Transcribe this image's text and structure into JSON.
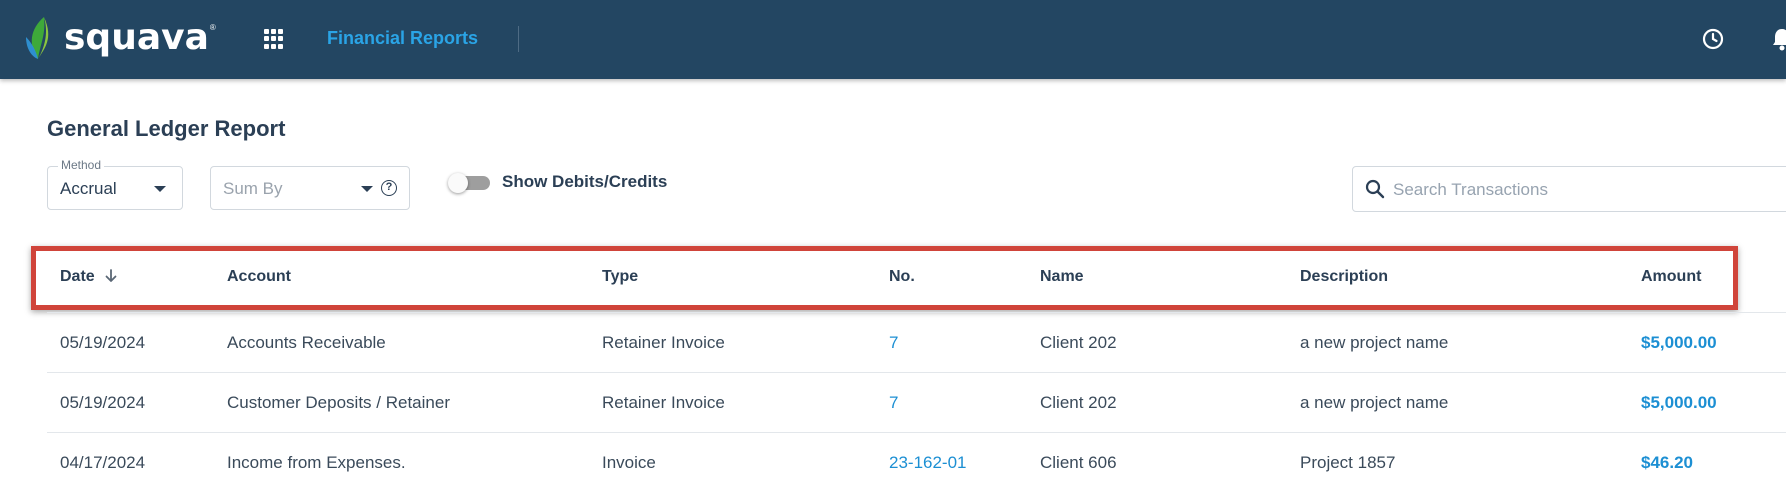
{
  "header": {
    "logo_text": "squava",
    "logo_reg": "®",
    "module_title": "Financial Reports",
    "icons": [
      "apps-grid-icon",
      "clock-icon",
      "bell-icon"
    ]
  },
  "page": {
    "title": "General Ledger Report"
  },
  "filters": {
    "method_label": "Method",
    "method_value": "Accrual",
    "sumby_placeholder": "Sum By",
    "help_glyph": "?",
    "toggle_label": "Show Debits/Credits",
    "toggle_on": false,
    "search_placeholder": "Search Transactions"
  },
  "table": {
    "headers": {
      "date": "Date",
      "account": "Account",
      "type": "Type",
      "no": "No.",
      "name": "Name",
      "description": "Description",
      "amount": "Amount"
    },
    "sort": {
      "column": "Date",
      "direction": "descending"
    },
    "rows": [
      {
        "date": "05/19/2024",
        "account": "Accounts Receivable",
        "type": "Retainer Invoice",
        "no": "7",
        "name": "Client 202",
        "description": "a new project name",
        "amount": "$5,000.00"
      },
      {
        "date": "05/19/2024",
        "account": "Customer Deposits / Retainer",
        "type": "Retainer Invoice",
        "no": "7",
        "name": "Client 202",
        "description": "a new project name",
        "amount": "$5,000.00"
      },
      {
        "date": "04/17/2024",
        "account": "Income from Expenses.",
        "type": "Invoice",
        "no": "23-162-01",
        "name": "Client 606",
        "description": "Project 1857",
        "amount": "$46.20"
      }
    ]
  },
  "colors": {
    "header_bg": "#234662",
    "accent": "#2aa4e6",
    "link": "#1c8fd3",
    "highlight": "#d0443a"
  }
}
